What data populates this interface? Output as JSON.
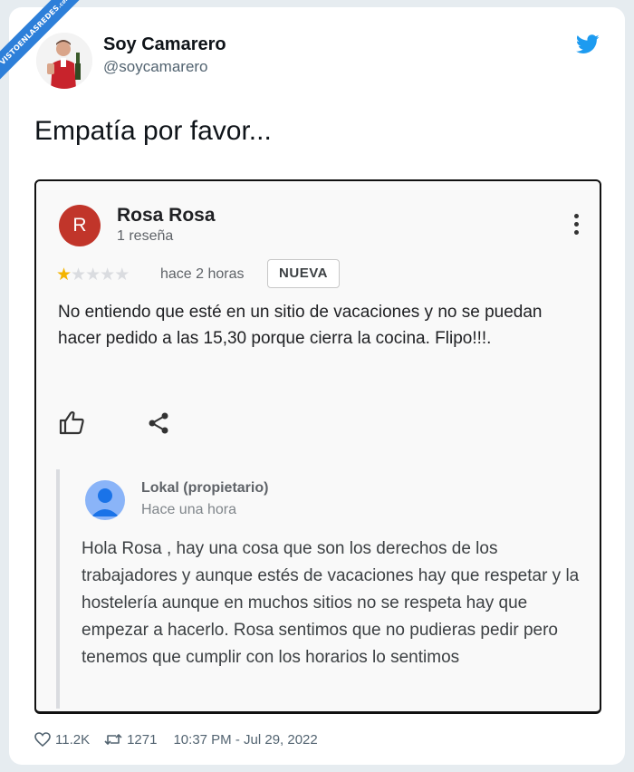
{
  "watermark": {
    "text": "VISTOENLASREDES",
    "sub": ".com"
  },
  "author": {
    "name": "Soy Camarero",
    "handle": "@soycamarero"
  },
  "tweet": {
    "text": "Empatía por favor..."
  },
  "review": {
    "avatar_letter": "R",
    "name": "Rosa Rosa",
    "count": "1 reseña",
    "rating": 1,
    "rating_max": 5,
    "time": "hace 2 horas",
    "badge": "NUEVA",
    "text": "No entiendo que esté en un sitio de vacaciones y no se puedan hacer pedido a las 15,30 porque cierra la cocina. Flipo!!!."
  },
  "owner_reply": {
    "name": "Lokal (propietario)",
    "time": "Hace una hora",
    "text": "Hola Rosa , hay una cosa que son los derechos de los trabajadores y aunque estés de vacaciones hay que respetar y la hostelería aunque en muchos sitios no se respeta hay que empezar a hacerlo. Rosa sentimos que no pudieras pedir pero tenemos que cumplir con los horarios lo sentimos"
  },
  "stats": {
    "likes": "11.2K",
    "retweets": "1271",
    "timestamp": "10:37 PM - Jul 29, 2022"
  },
  "icons": {
    "like": "heart-icon",
    "retweet": "retweet-icon",
    "brand": "twitter-bird-icon",
    "menu": "more-vertical-icon",
    "thumbs": "thumbs-up-icon",
    "share": "share-icon"
  },
  "colors": {
    "twitter_blue": "#1d9bf0",
    "review_avatar": "#c1352a",
    "star": "#f4b400",
    "ribbon": "#2d7fd9"
  }
}
